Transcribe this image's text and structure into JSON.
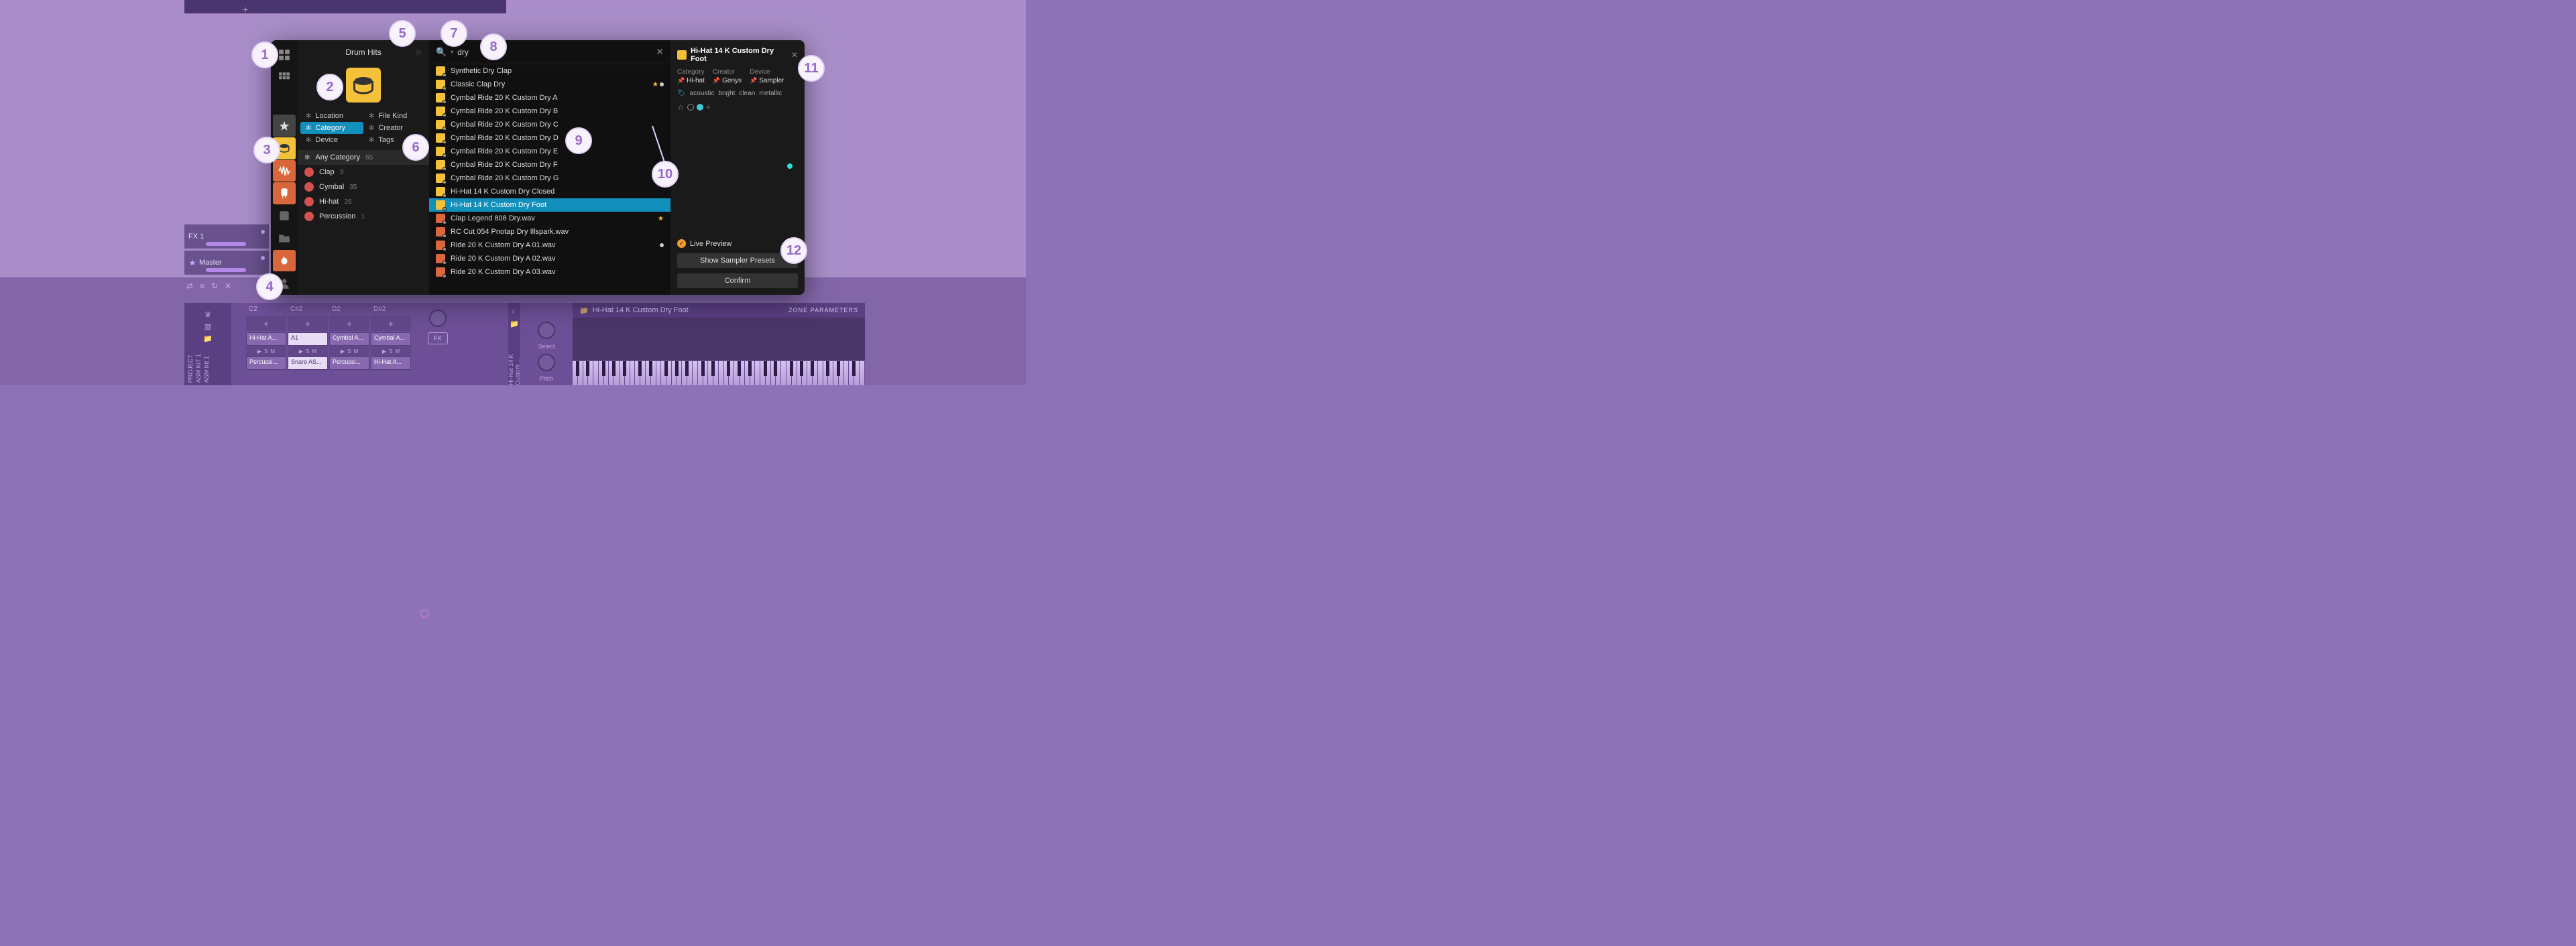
{
  "annotations": [
    "1",
    "2",
    "3",
    "4",
    "5",
    "6",
    "7",
    "8",
    "9",
    "10",
    "11",
    "12"
  ],
  "bg": {
    "plus": "+"
  },
  "tracks": {
    "fx1": "FX 1",
    "master": "Master"
  },
  "bottom_toolbar": [
    "⇄",
    "≡",
    "↻",
    "✕"
  ],
  "browser": {
    "title": "Drum Hits",
    "search_value": "dry",
    "filters": {
      "location": "Location",
      "file_kind": "File Kind",
      "category": "Category",
      "creator": "Creator",
      "device": "Device",
      "tags": "Tags"
    },
    "categories": {
      "any": "Any Category",
      "any_count": "65",
      "items": [
        {
          "name": "Clap",
          "count": "3"
        },
        {
          "name": "Cymbal",
          "count": "35"
        },
        {
          "name": "Hi-hat",
          "count": "26"
        },
        {
          "name": "Percussion",
          "count": "1"
        }
      ]
    },
    "results": [
      {
        "name": "Synthetic Dry Clap",
        "type": "sampler"
      },
      {
        "name": "Classic Clap Dry",
        "type": "sampler",
        "star": true,
        "dot": true
      },
      {
        "name": "Cymbal Ride 20 K Custom Dry A",
        "type": "sampler"
      },
      {
        "name": "Cymbal Ride 20 K Custom Dry B",
        "type": "sampler"
      },
      {
        "name": "Cymbal Ride 20 K Custom Dry C",
        "type": "sampler"
      },
      {
        "name": "Cymbal Ride 20 K Custom Dry D",
        "type": "sampler"
      },
      {
        "name": "Cymbal Ride 20 K Custom Dry E",
        "type": "sampler"
      },
      {
        "name": "Cymbal Ride 20 K Custom Dry F",
        "type": "sampler"
      },
      {
        "name": "Cymbal Ride 20 K Custom Dry G",
        "type": "sampler"
      },
      {
        "name": "Hi-Hat 14 K Custom Dry Closed",
        "type": "sampler"
      },
      {
        "name": "Hi-Hat 14 K Custom Dry Foot",
        "type": "sampler",
        "selected": true
      },
      {
        "name": "Clap Legend 808 Dry.wav",
        "type": "wav",
        "star": true
      },
      {
        "name": "RC Cut 054 Pnotap Dry Illspark.wav",
        "type": "wav"
      },
      {
        "name": "Ride 20 K Custom Dry A 01.wav",
        "type": "wav",
        "dot": true
      },
      {
        "name": "Ride 20 K Custom Dry A 02.wav",
        "type": "wav"
      },
      {
        "name": "Ride 20 K Custom Dry A 03.wav",
        "type": "wav"
      }
    ],
    "detail": {
      "title": "Hi-Hat 14 K Custom Dry Foot",
      "meta": {
        "category_label": "Category",
        "category_value": "Hi-hat",
        "creator_label": "Creator",
        "creator_value": "Genys",
        "device_label": "Device",
        "device_value": "Sampler"
      },
      "tags": [
        "acoustic",
        "bright",
        "clean",
        "metallic"
      ],
      "live_preview": "Live Preview",
      "btn_presets": "Show Sampler Presets",
      "btn_confirm": "Confirm"
    }
  },
  "device": {
    "cells": {
      "c2": "C2",
      "csharp2": "C#2",
      "d2": "D2",
      "dsharp2": "D#2",
      "row1": [
        "Hi-Hat A...",
        "A1",
        "Cymbal A...",
        "Cymbal A..."
      ],
      "row2": [
        "Percussi...",
        "Snare AS...",
        "Percussi...",
        "Hi-Hat A..."
      ]
    },
    "labels": {
      "project": "PROJECT",
      "kit1": "ASM KIT 1",
      "kit1b": "ASM Kit 1"
    },
    "fx": "FX",
    "smb": {
      "play": "▶",
      "s": "S",
      "m": "M"
    }
  },
  "sampler": {
    "select": "Select",
    "pitch": "Pitch",
    "file": "Hi-Hat 14 K Custom Dry Foot",
    "zone": "ZONE PARAMETERS",
    "side_label": "Hi-Hat 14 K Custom ..."
  }
}
